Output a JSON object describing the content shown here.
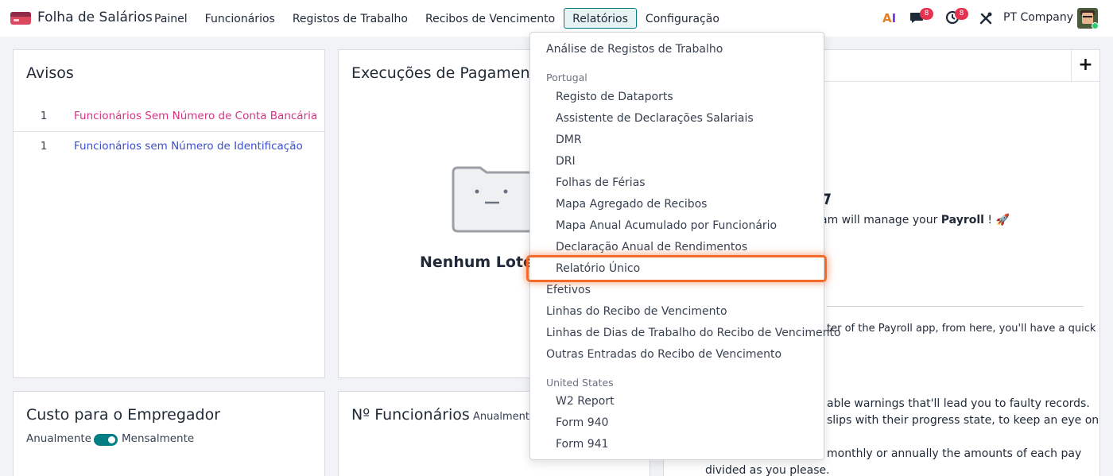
{
  "app": {
    "title": "Folha de Salários"
  },
  "nav": {
    "items": [
      "Painel",
      "Funcionários",
      "Registos de Trabalho",
      "Recibos de Vencimento",
      "Relatórios",
      "Configuração"
    ],
    "active": "Relatórios"
  },
  "topbar": {
    "ai_label_a": "A",
    "ai_label_i": "I",
    "chat_badge": "8",
    "activity_badge": "8",
    "company": "PT Company"
  },
  "warnings_card": {
    "title": "Avisos",
    "rows": [
      {
        "count": "1",
        "label": "Funcionários Sem Número de Conta Bancária",
        "color": "#d63384"
      },
      {
        "count": "1",
        "label": "Funcionários sem Número de Identificação",
        "color": "#3b4fc9"
      }
    ]
  },
  "payslip_runs_card": {
    "title": "Execuções de Pagamen",
    "empty_title": "Nenhum Lote A"
  },
  "employer_cost_card": {
    "title": "Custo para o Empregador",
    "toggle_left": "Anualmente",
    "toggle_right": "Mensalmente"
  },
  "employees_card": {
    "title": "Nº Funcionários",
    "period": "Anualmente"
  },
  "right_card": {
    "plus": "+",
    "subtitle_pre": "am will manage your ",
    "subtitle_bold": "Payroll",
    "subtitle_post": " ! 🚀",
    "line1": "ter of the Payroll app, from here, you'll have a quick",
    "line2": "able warnings that'll lead you to faulty records.",
    "line3": "slips with their progress state, to keep an eye on",
    "line4": "monthly or annually the amounts of each pay",
    "line5": "divided as you please."
  },
  "dropdown": {
    "top_item": "Análise de Registos de Trabalho",
    "portugal_header": "Portugal",
    "portugal_items": [
      "Registo de Dataports",
      "Assistente de Declarações Salariais",
      "DMR",
      "DRI",
      "Folhas de Férias",
      "Mapa Agregado de Recibos",
      "Mapa Anual Acumulado por Funcionário",
      "Declaração Anual de Rendimentos",
      "Relatório Único"
    ],
    "general_items": [
      "Efetivos",
      "Linhas do Recibo de Vencimento",
      "Linhas de Dias de Trabalho do Recibo de Vencimento",
      "Outras Entradas do Recibo de Vencimento"
    ],
    "us_header": "United States",
    "us_items": [
      "W2 Report",
      "Form 940",
      "Form 941"
    ],
    "highlighted": "Relatório Único"
  },
  "colors": {
    "accent": "#017e84",
    "highlight": "#f26b2a",
    "badge": "#e4324f"
  }
}
